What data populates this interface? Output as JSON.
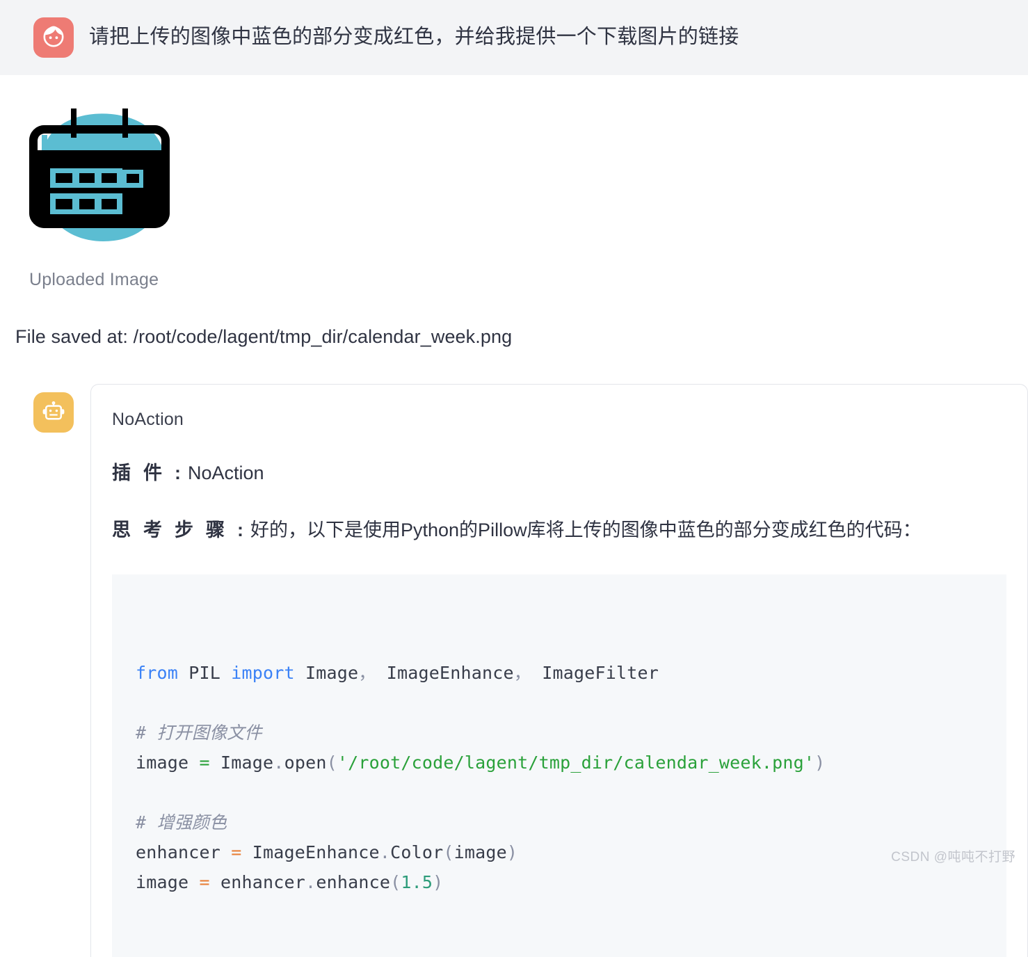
{
  "user_message": {
    "avatar_icon": "girl-face-icon",
    "avatar_color": "#EE7B74",
    "text": "请把上传的图像中蓝色的部分变成红色，并给我提供一个下载图片的链接"
  },
  "uploaded": {
    "image_icon": "calendar-week-icon",
    "image_colors": {
      "blob": "#5BBDD2",
      "body": "#000000",
      "cell": "#5BBDD2"
    },
    "caption": "Uploaded Image",
    "file_saved_text": "File saved at: /root/code/lagent/tmp_dir/calendar_week.png"
  },
  "assistant": {
    "avatar_icon": "robot-icon",
    "avatar_color": "#F3C05C",
    "card_title": "NoAction",
    "plugin_label": "插件",
    "plugin_colon": ":",
    "plugin_value": "NoAction",
    "thought_label": "思考步骤",
    "thought_colon": ":",
    "thought_value": "好的，以下是使用Python的Pillow库将上传的图像中蓝色的部分变成红色的代码："
  },
  "code": {
    "language": "python",
    "lines": [
      [
        {
          "t": "from ",
          "c": "kw"
        },
        {
          "t": "PIL ",
          "c": "plain"
        },
        {
          "t": "import ",
          "c": "kw"
        },
        {
          "t": "Image",
          "c": "plain"
        },
        {
          "t": "，",
          "c": "punct"
        },
        {
          "t": " ImageEnhance",
          "c": "plain"
        },
        {
          "t": "，",
          "c": "punct"
        },
        {
          "t": " ImageFilter",
          "c": "plain"
        }
      ],
      [],
      [
        {
          "t": "# 打开图像文件",
          "c": "cmt"
        }
      ],
      [
        {
          "t": "image ",
          "c": "plain"
        },
        {
          "t": "=",
          "c": "op-g"
        },
        {
          "t": " Image",
          "c": "plain"
        },
        {
          "t": ".",
          "c": "punct"
        },
        {
          "t": "open",
          "c": "plain"
        },
        {
          "t": "(",
          "c": "punct"
        },
        {
          "t": "'/root/code/lagent/tmp_dir/calendar_week.png'",
          "c": "str"
        },
        {
          "t": ")",
          "c": "punct"
        }
      ],
      [],
      [
        {
          "t": "# 增强颜色",
          "c": "cmt"
        }
      ],
      [
        {
          "t": "enhancer ",
          "c": "plain"
        },
        {
          "t": "=",
          "c": "op"
        },
        {
          "t": " ImageEnhance",
          "c": "plain"
        },
        {
          "t": ".",
          "c": "punct"
        },
        {
          "t": "Color",
          "c": "plain"
        },
        {
          "t": "(",
          "c": "punct"
        },
        {
          "t": "image",
          "c": "plain"
        },
        {
          "t": ")",
          "c": "punct"
        }
      ],
      [
        {
          "t": "image ",
          "c": "plain"
        },
        {
          "t": "=",
          "c": "op"
        },
        {
          "t": " enhancer",
          "c": "plain"
        },
        {
          "t": ".",
          "c": "punct"
        },
        {
          "t": "enhance",
          "c": "plain"
        },
        {
          "t": "(",
          "c": "punct"
        },
        {
          "t": "1.5",
          "c": "num"
        },
        {
          "t": ")",
          "c": "punct"
        }
      ]
    ]
  },
  "watermark": "CSDN @吨吨不打野"
}
